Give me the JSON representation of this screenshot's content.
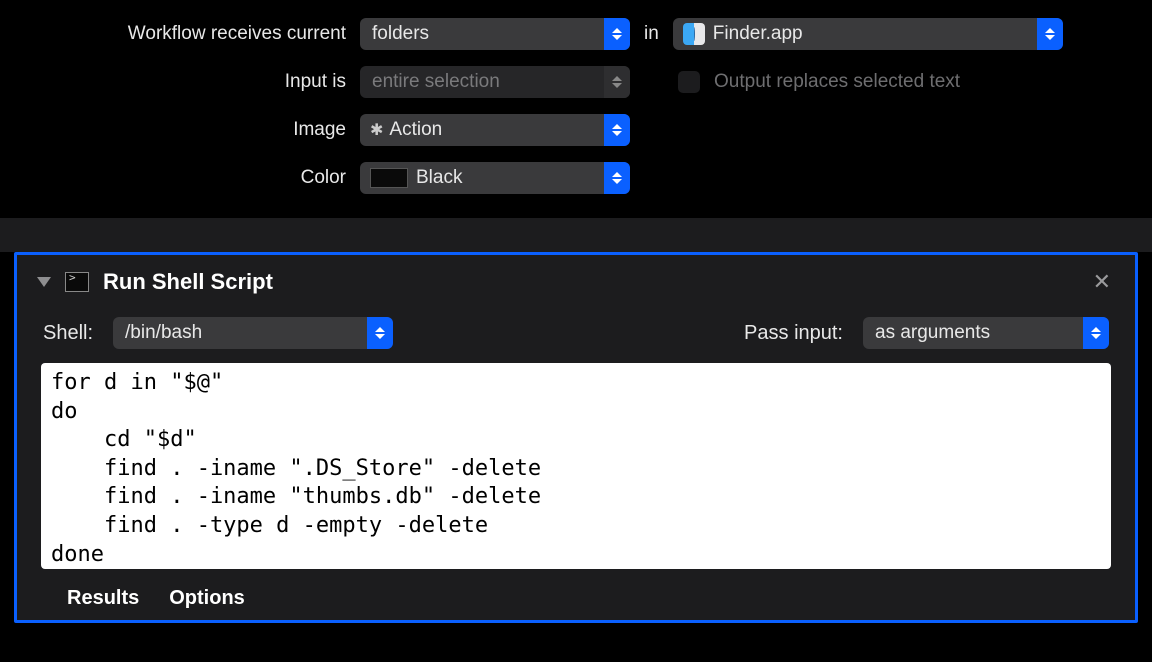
{
  "config": {
    "workflow_receives_label": "Workflow receives current",
    "receives_value": "folders",
    "in_label": "in",
    "app_value": "Finder.app",
    "input_is_label": "Input is",
    "input_is_value": "entire selection",
    "output_replaces_label": "Output replaces selected text",
    "image_label": "Image",
    "image_value": "Action",
    "color_label": "Color",
    "color_value": "Black"
  },
  "action": {
    "title": "Run Shell Script",
    "shell_label": "Shell:",
    "shell_value": "/bin/bash",
    "pass_input_label": "Pass input:",
    "pass_input_value": "as arguments",
    "script": "for d in \"$@\"\ndo\n    cd \"$d\"\n    find . -iname \".DS_Store\" -delete\n    find . -iname \"thumbs.db\" -delete\n    find . -type d -empty -delete\ndone",
    "results_label": "Results",
    "options_label": "Options"
  }
}
